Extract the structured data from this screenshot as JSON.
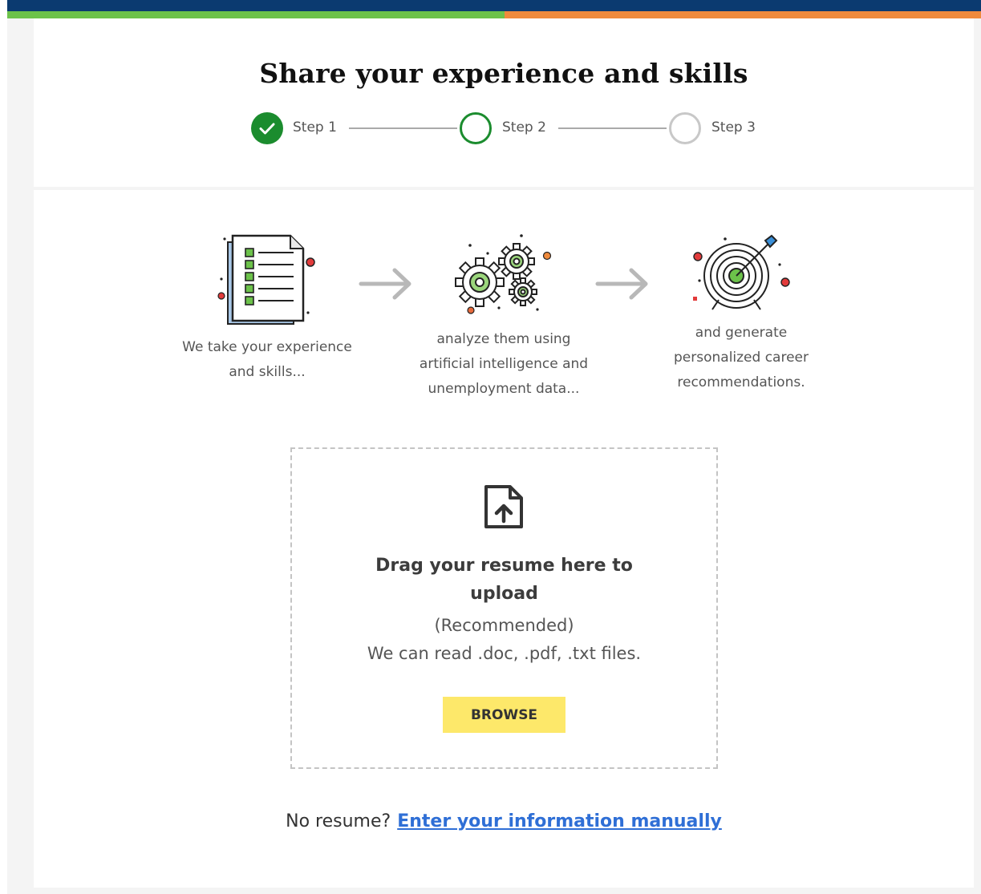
{
  "header": {
    "title": "Share your experience and skills",
    "progress_colors": {
      "navy": "#0b3a70",
      "green": "#6cc24a",
      "orange": "#ef8a3c"
    }
  },
  "steps": [
    {
      "label": "Step 1",
      "state": "complete",
      "icon": "check-icon"
    },
    {
      "label": "Step 2",
      "state": "current"
    },
    {
      "label": "Step 3",
      "state": "pending"
    }
  ],
  "process": [
    {
      "icon": "document-checklist-icon",
      "lines": [
        "We take your experience",
        "and skills..."
      ]
    },
    {
      "icon": "gears-icon",
      "lines": [
        "analyze them using",
        "artificial intelligence and",
        "unemployment data..."
      ]
    },
    {
      "icon": "target-icon",
      "lines": [
        "and generate",
        "personalized career",
        "recommendations."
      ]
    }
  ],
  "upload": {
    "icon": "file-upload-icon",
    "title_lines": [
      "Drag your resume here to",
      "upload"
    ],
    "recommended": "(Recommended)",
    "formats": "We can read .doc, .pdf, .txt files.",
    "browse_label": "BROWSE"
  },
  "manual": {
    "prompt": "No resume?",
    "link": "Enter your information manually"
  },
  "colors": {
    "step_green": "#1b8c2e",
    "browse_yellow": "#fde86a",
    "link_blue": "#2f6fd6"
  }
}
